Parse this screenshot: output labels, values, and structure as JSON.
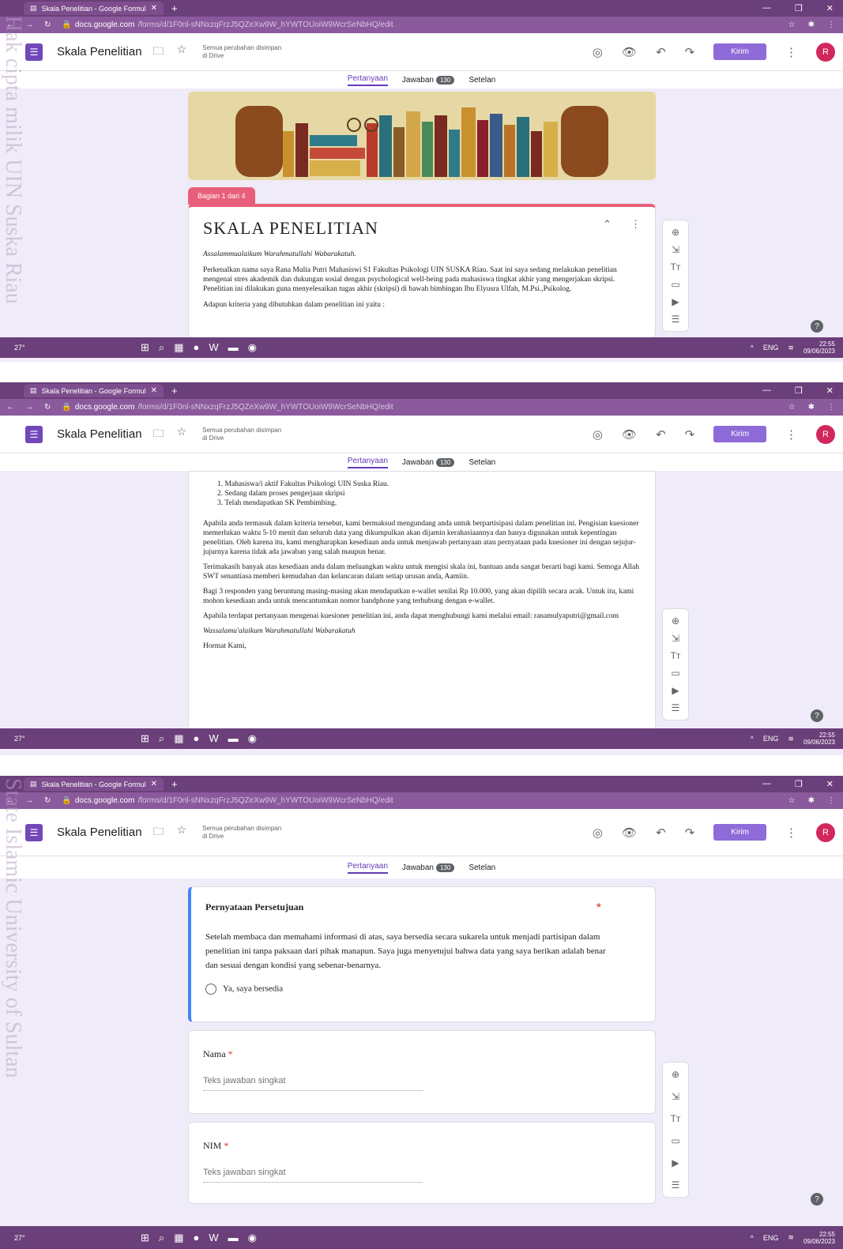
{
  "browser": {
    "tab_title": "Skala Penelitian - Google Formul",
    "url_host": "docs.google.com",
    "url_path": "/forms/d/1F0nl-sNNxzqFrzJ5QZeXw9W_hYWTOUoiW9WcrSeNbHQ/edit",
    "avatar_small": "R"
  },
  "form": {
    "title": "Skala Penelitian",
    "saved_line1": "Semua perubahan disimpan",
    "saved_line2": "di Drive",
    "send_label": "Kirim",
    "avatar": "R"
  },
  "tabs": {
    "questions": "Pertanyaan",
    "responses": "Jawaban",
    "responses_count": "130",
    "settings": "Setelan"
  },
  "section": {
    "tab_label": "Bagian 1 dari 4",
    "title": "SKALA PENELITIAN"
  },
  "text": {
    "greeting": "Assalammualaikum Warahmatullahi Wabarakatuh.",
    "intro": "Perkenalkan nama saya Rana Mulia Putri Mahasiswi S1 Fakultas Psikologi UIN SUSKA Riau.  Saat ini saya sedang melakukan penelitian mengenai stres akademik dan dukungan sosial dengan psychological well-being pada mahasiswa tingkat akhir yang mengerjakan skripsi.  Penelitian ini dilakukan guna menyelesaikan tugas akhir (skripsi) di bawah bimbingan Ibu Elyusra Ulfah, M.Psi.,Psikolog.",
    "criteria_intro": "Adapun kriteria yang dibutuhkan dalam penelitian ini yaitu :",
    "criteria": [
      "1. Mahasiswa/i aktif Fakultas Psikologi UIN Suska Riau.",
      "2. Sedang dalam proses pengerjaan skripsi",
      "3. Telah mendapatkan SK Pembimbing."
    ],
    "p1": "Apabila anda termasuk dalam kriteria tersebut, kami bermaksud mengundang anda untuk berpartisipasi dalam penelitian ini. Pengisian kuesioner memerlukan waktu 5-10 menit dan seluruh data yang dikumpulkan akan dijamin kerahasiaannya dan hanya digunakan untuk kepentingan penelitian. Oleh karena itu, kami mengharapkan kesediaan anda untuk menjawab pertanyaan atau pernyataan pada kuesioner ini dengan sejujur-jujurnya karena tidak ada jawaban yang salah maupun benar.",
    "p2": "Terimakasih banyak atas kesediaan anda dalam meluangkan waktu untuk mengisi skala ini, bantuan anda sangat berarti bagi kami. Semoga Allah SWT senantiasa memberi kemudahan dan kelancaran dalam setiap urusan anda, Aamiin.",
    "p3": "Bagi 3 responden yang beruntung masing-masing akan mendapatkan e-wallet senilai Rp 10.000, yang akan dipilih secara acak. Untuk itu, kami mohon kesediaan anda untuk mencantumkan nomor handphone yang terhubung dengan e-wallet.",
    "p4": "Apabila terdapat pertanyaan mengenai kuesioner penelitian ini, anda dapat menghubungi kami melalui email: ranamulyaputri@gmail.com",
    "closing": "Wassalamu'alaikum Warahmatullahi Wabarakatuh",
    "signoff": "Hormat Kami,"
  },
  "consent": {
    "title": "Pernyataan Persetujuan",
    "body": "Setelah membaca dan memahami informasi di atas, saya bersedia secara sukarela untuk menjadi partisipan dalam penelitian ini tanpa paksaan dari pihak manapun. Saya juga menyetujui bahwa data yang saya berikan adalah benar dan sesuai dengan kondisi yang sebenar-benarnya.",
    "option": "Ya, saya bersedia",
    "required_mark": "*"
  },
  "q_name": {
    "label": "Nama",
    "required_mark": "*",
    "placeholder": "Teks jawaban singkat"
  },
  "q_nim": {
    "label": "NIM",
    "required_mark": "*",
    "placeholder": "Teks jawaban singkat"
  },
  "taskbar": {
    "temp": "27°",
    "lang": "ENG",
    "time": "22:55",
    "date": "09/06/2023"
  },
  "watermark": {
    "left": "Hak cipta milik UIN Suska Riau",
    "right": "State Islamic University of Sultan"
  },
  "colors": {
    "accent": "#673ab7",
    "section": "#e85f7b",
    "frame": "#6b3f7a"
  }
}
